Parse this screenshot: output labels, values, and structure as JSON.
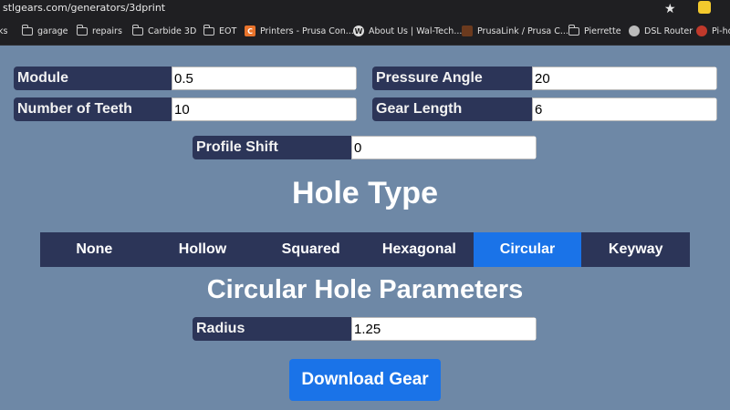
{
  "browser": {
    "url": "stlgears.com/generators/3dprint",
    "bookmarks": [
      {
        "label": "ks",
        "icon": "none"
      },
      {
        "label": "garage",
        "icon": "folder-icon"
      },
      {
        "label": "repairs",
        "icon": "folder-icon"
      },
      {
        "label": "Carbide 3D",
        "icon": "folder-icon"
      },
      {
        "label": "EOT",
        "icon": "folder-icon"
      },
      {
        "label": "Printers - Prusa Con...",
        "icon": "c-favicon"
      },
      {
        "label": "About Us | Wal-Tech...",
        "icon": "wordpress-icon"
      },
      {
        "label": "PrusaLink / Prusa C...",
        "icon": "prusa-icon"
      },
      {
        "label": "Pierrette",
        "icon": "folder-icon"
      },
      {
        "label": "DSL Router",
        "icon": "globe-icon"
      },
      {
        "label": "Pi-ho",
        "icon": "raspberry-icon"
      }
    ]
  },
  "gear": {
    "module": {
      "label": "Module",
      "value": "0.5"
    },
    "pressure_angle": {
      "label": "Pressure Angle",
      "value": "20"
    },
    "teeth": {
      "label": "Number of Teeth",
      "value": "10"
    },
    "length": {
      "label": "Gear Length",
      "value": "6"
    },
    "profile_shift": {
      "label": "Profile Shift",
      "value": "0"
    }
  },
  "hole_type": {
    "heading": "Hole Type",
    "tabs": [
      "None",
      "Hollow",
      "Squared",
      "Hexagonal",
      "Circular",
      "Keyway"
    ],
    "selected": "Circular"
  },
  "params": {
    "heading": "Circular Hole Parameters",
    "radius": {
      "label": "Radius",
      "value": "1.25"
    }
  },
  "download_label": "Download Gear",
  "colors": {
    "accent": "#1a73e8",
    "label_bg": "#2c3558",
    "page_bg": "#6e88a6"
  }
}
